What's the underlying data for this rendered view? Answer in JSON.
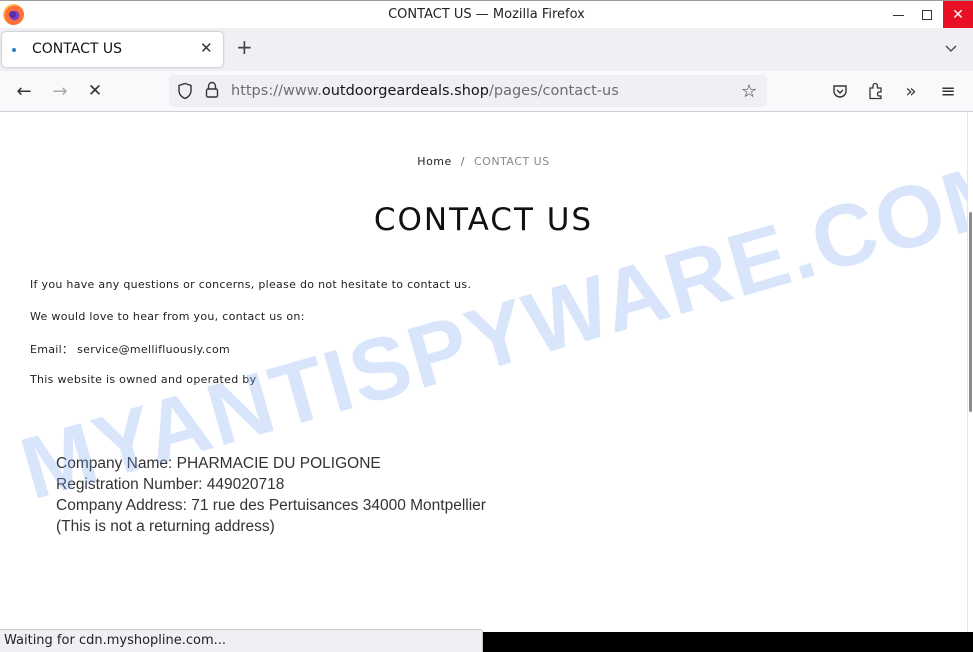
{
  "window": {
    "title": "CONTACT US — Mozilla Firefox",
    "minimize_icon": "minimize-icon",
    "maximize_icon": "maximize-icon",
    "close_icon": "close-icon",
    "close_color": "#e81123"
  },
  "tabs": [
    {
      "label": "CONTACT US",
      "active": true,
      "loading_dot_color": "#2d7fc4"
    }
  ],
  "tabstrip": {
    "new_tab": "+",
    "list_all_tabs_icon": "chevron-down-icon"
  },
  "navbar": {
    "back_icon": "←",
    "forward_icon": "→",
    "stop_icon": "✕",
    "url_prefix": "https://www.",
    "url_domain": "outdoorgeardeals.shop",
    "url_path": "/pages/contact-us",
    "bookmark_icon": "☆",
    "more_tools_icon": "»",
    "menu_icon": "≡"
  },
  "page": {
    "breadcrumb": {
      "home": "Home",
      "separator": "/",
      "current": "CONTACT US"
    },
    "title": "CONTACT US",
    "paragraphs": [
      "If you have any questions or concerns, please do not hesitate to contact us.",
      "We would love to hear from you, contact us on:",
      "Email： service@mellifluously.com",
      "This website is owned and operated by"
    ],
    "company": {
      "name": "Company Name: PHARMACIE DU POLIGONE",
      "registration": "Registration Number: 449020718",
      "address": "Company Address: 71 rue des Pertuisances 34000 Montpellier",
      "note": "(This is not a returning address)"
    },
    "watermark": "MYANTISPYWARE.COM"
  },
  "statusbar": {
    "text": "Waiting for cdn.myshopline.com..."
  }
}
